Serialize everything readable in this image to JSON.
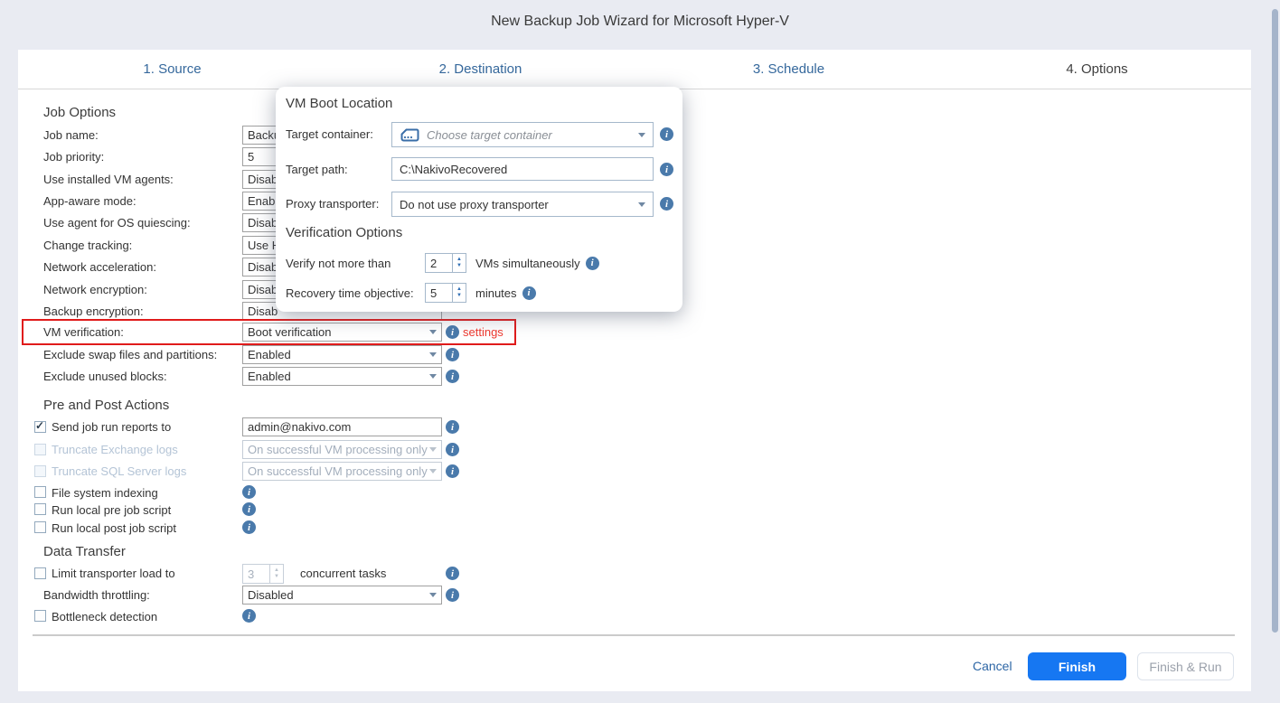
{
  "window": {
    "title": "New Backup Job Wizard for Microsoft Hyper-V"
  },
  "tabs": [
    {
      "label": "1. Source"
    },
    {
      "label": "2. Destination"
    },
    {
      "label": "3. Schedule"
    },
    {
      "label": "4. Options"
    }
  ],
  "job_options": {
    "heading": "Job Options",
    "rows": [
      {
        "label": "Job name:",
        "value": "Backu"
      },
      {
        "label": "Job priority:",
        "value": "5"
      },
      {
        "label": "Use installed VM agents:",
        "value": "Disab"
      },
      {
        "label": "App-aware mode:",
        "value": "Enabl"
      },
      {
        "label": "Use agent for OS quiescing:",
        "value": "Disab"
      },
      {
        "label": "Change tracking:",
        "value": "Use H"
      },
      {
        "label": "Network acceleration:",
        "value": "Disab"
      },
      {
        "label": "Network encryption:",
        "value": "Disab"
      },
      {
        "label": "Backup encryption:",
        "value": "Disab"
      },
      {
        "label": "VM verification:",
        "value": "Boot verification",
        "settings_link": "settings"
      },
      {
        "label": "Exclude swap files and partitions:",
        "value": "Enabled"
      },
      {
        "label": "Exclude unused blocks:",
        "value": "Enabled"
      }
    ]
  },
  "popup": {
    "boot_location_heading": "VM Boot Location",
    "target_container_label": "Target container:",
    "target_container_value": "Choose target container",
    "target_path_label": "Target path:",
    "target_path_value": "C:\\NakivoRecovered",
    "proxy_label": "Proxy transporter:",
    "proxy_value": "Do not use proxy transporter",
    "verification_heading": "Verification Options",
    "verify_label": "Verify not more than",
    "verify_value": "2",
    "verify_suffix": "VMs simultaneously",
    "rto_label": "Recovery time objective:",
    "rto_value": "5",
    "rto_suffix": "minutes"
  },
  "pre_post": {
    "heading": "Pre and Post Actions",
    "send_reports": {
      "label": "Send job run reports to",
      "value": "admin@nakivo.com"
    },
    "truncate_exchange": {
      "label": "Truncate Exchange logs",
      "value": "On successful VM processing only"
    },
    "truncate_sql": {
      "label": "Truncate SQL Server logs",
      "value": "On successful VM processing only"
    },
    "fs_indexing": {
      "label": "File system indexing"
    },
    "pre_script": {
      "label": "Run local pre job script"
    },
    "post_script": {
      "label": "Run local post job script"
    }
  },
  "data_transfer": {
    "heading": "Data Transfer",
    "limit_load": {
      "label": "Limit transporter load to",
      "value": "3",
      "suffix": "concurrent tasks"
    },
    "bandwidth": {
      "label": "Bandwidth throttling:",
      "value": "Disabled"
    },
    "bottleneck": {
      "label": "Bottleneck detection"
    }
  },
  "footer": {
    "cancel": "Cancel",
    "finish": "Finish",
    "finish_run": "Finish & Run"
  },
  "icons": {
    "info": "i",
    "target_container": "storage-container-icon"
  },
  "colors": {
    "accent_blue": "#1677f2",
    "tab_link_blue": "#35689c",
    "settings_red": "#ef382e",
    "highlight_red": "#e01b1b",
    "info_icon_blue": "#4a7aab"
  }
}
